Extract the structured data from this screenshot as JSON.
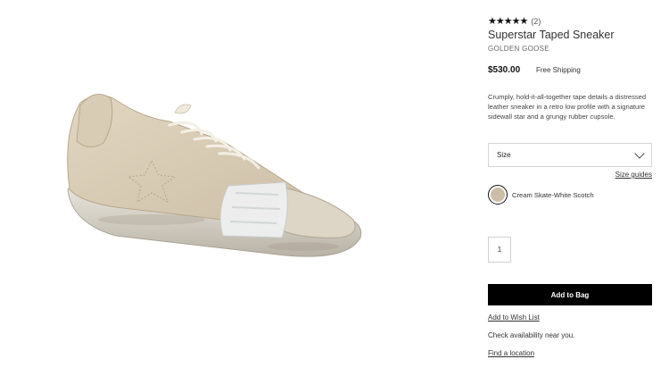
{
  "product": {
    "stars": "★★★★★",
    "review_count": "(2)",
    "title": "Superstar Taped Sneaker",
    "brand": "GOLDEN GOOSE",
    "price": "$530.00",
    "shipping": "Free Shipping",
    "description": "Crumply, hold-it-all-together tape details a distressed leather sneaker in a retro low profile with a signature sidewall star and a grungy rubber cupsole."
  },
  "size": {
    "label": "Size",
    "guides_link": "Size guides"
  },
  "color": {
    "name": "Cream Skate-White Scotch",
    "swatch_hex": "#cdbfa7"
  },
  "quantity": "1",
  "actions": {
    "add_to_bag": "Add to Bag",
    "wish_list": "Add to Wish List",
    "availability": "Check availability near you.",
    "find_location": "Find a location"
  },
  "image": {
    "icon": "sneaker-image"
  }
}
